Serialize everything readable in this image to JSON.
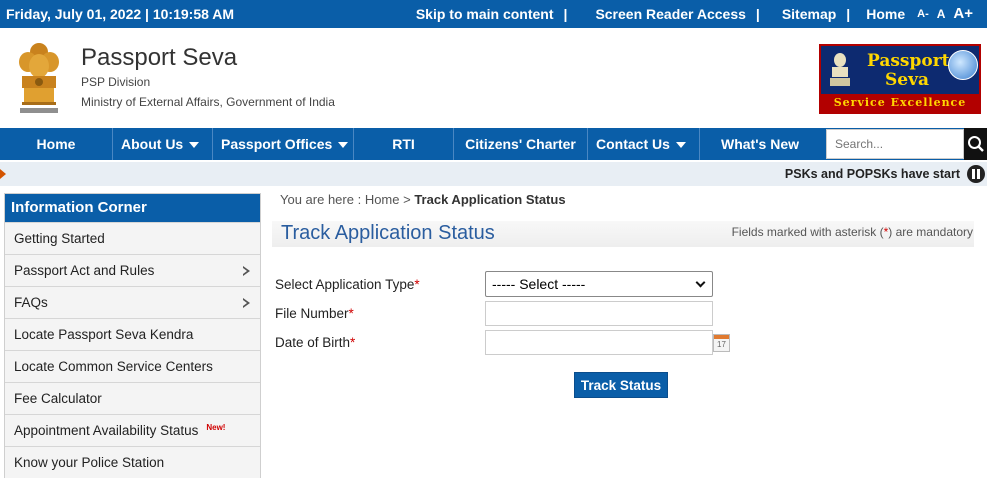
{
  "topbar": {
    "datetime": "Friday,  July  01, 2022 | 10:19:58 AM",
    "skip": "Skip to main content",
    "screen_reader": "Screen Reader Access",
    "sitemap": "Sitemap",
    "home": "Home",
    "sep": "|",
    "font_small": "A-",
    "font_normal": "A",
    "font_large": "A+"
  },
  "header": {
    "title": "Passport Seva",
    "division": "PSP Division",
    "ministry": "Ministry of External Affairs, Government of India",
    "logo_line1": "Passport",
    "logo_line2": "Seva",
    "logo_tagline": "Service Excellence"
  },
  "nav": {
    "items": [
      {
        "label": "Home",
        "caret": false
      },
      {
        "label": "About Us",
        "caret": true
      },
      {
        "label": "Passport Offices",
        "caret": true
      },
      {
        "label": "RTI",
        "caret": false
      },
      {
        "label": "Citizens' Charter",
        "caret": false
      },
      {
        "label": "Contact Us",
        "caret": true
      },
      {
        "label": "What's New",
        "caret": false
      }
    ],
    "search_placeholder": "Search..."
  },
  "ticker": {
    "text": "PSKs and POPSKs have start"
  },
  "sidebar": {
    "heading": "Information Corner",
    "items": [
      {
        "label": "Getting Started"
      },
      {
        "label": "Passport Act and Rules",
        "submenu": true
      },
      {
        "label": "FAQs",
        "submenu": true
      },
      {
        "label": "Locate Passport Seva Kendra"
      },
      {
        "label": "Locate Common Service Centers"
      },
      {
        "label": "Fee Calculator"
      },
      {
        "label": "Appointment Availability Status",
        "badge": "New!"
      },
      {
        "label": "Know your Police Station"
      }
    ]
  },
  "main": {
    "breadcrumb_prefix": "You are here : ",
    "breadcrumb_home": "Home",
    "breadcrumb_sep": " > ",
    "breadcrumb_current": "Track Application Status",
    "title": "Track Application Status",
    "mandatory_pre": "Fields marked with asterisk (",
    "mandatory_star": "*",
    "mandatory_post": ") are mandatory",
    "form": {
      "app_type_label": "Select Application Type",
      "app_type_value": "----- Select -----",
      "file_number_label": "File Number",
      "file_number_value": "",
      "dob_label": "Date of Birth",
      "dob_value": "",
      "required_mark": "*",
      "calendar_day": "17",
      "submit_label": "Track Status"
    }
  },
  "colors": {
    "brand_blue": "#0a5ea8",
    "title_blue": "#2a5d9f",
    "required_red": "#d00000"
  }
}
